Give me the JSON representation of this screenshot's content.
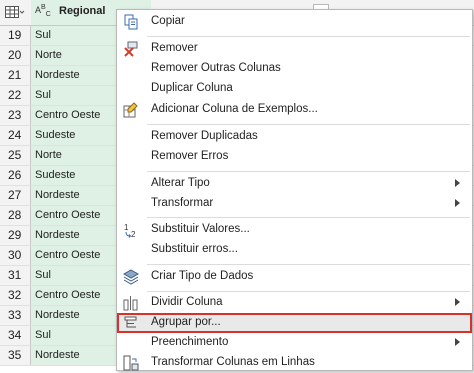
{
  "header": {
    "regional_label": "Regional",
    "type_icon": "ABC",
    "type_icon_symbol": "Aᴮᴄ"
  },
  "rows": [
    {
      "n": "19",
      "regional": "Sul"
    },
    {
      "n": "20",
      "regional": "Norte"
    },
    {
      "n": "21",
      "regional": "Nordeste"
    },
    {
      "n": "22",
      "regional": "Sul"
    },
    {
      "n": "23",
      "regional": "Centro Oeste"
    },
    {
      "n": "24",
      "regional": "Sudeste"
    },
    {
      "n": "25",
      "regional": "Norte"
    },
    {
      "n": "26",
      "regional": "Sudeste"
    },
    {
      "n": "27",
      "regional": "Nordeste"
    },
    {
      "n": "28",
      "regional": "Centro Oeste"
    },
    {
      "n": "29",
      "regional": "Nordeste"
    },
    {
      "n": "30",
      "regional": "Centro Oeste"
    },
    {
      "n": "31",
      "regional": "Sul"
    },
    {
      "n": "32",
      "regional": "Centro Oeste"
    },
    {
      "n": "33",
      "regional": "Nordeste"
    },
    {
      "n": "34",
      "regional": "Sul"
    },
    {
      "n": "35",
      "regional": "Nordeste"
    }
  ],
  "menu": {
    "copiar": "Copiar",
    "remover": "Remover",
    "remover_outras": "Remover Outras Colunas",
    "duplicar": "Duplicar Coluna",
    "adicionar_exemplos": "Adicionar Coluna de Exemplos...",
    "remover_duplicadas": "Remover Duplicadas",
    "remover_erros": "Remover Erros",
    "alterar_tipo": "Alterar Tipo",
    "transformar": "Transformar",
    "substituir_valores": "Substituir Valores...",
    "substituir_erros": "Substituir erros...",
    "criar_tipo": "Criar Tipo de Dados",
    "dividir_coluna": "Dividir Coluna",
    "agrupar": "Agrupar por...",
    "preenchimento": "Preenchimento",
    "transformar_linhas": "Transformar Colunas em Linhas"
  },
  "colors": {
    "highlight_border": "#d9302c",
    "selected_column": "#dff0e4"
  }
}
